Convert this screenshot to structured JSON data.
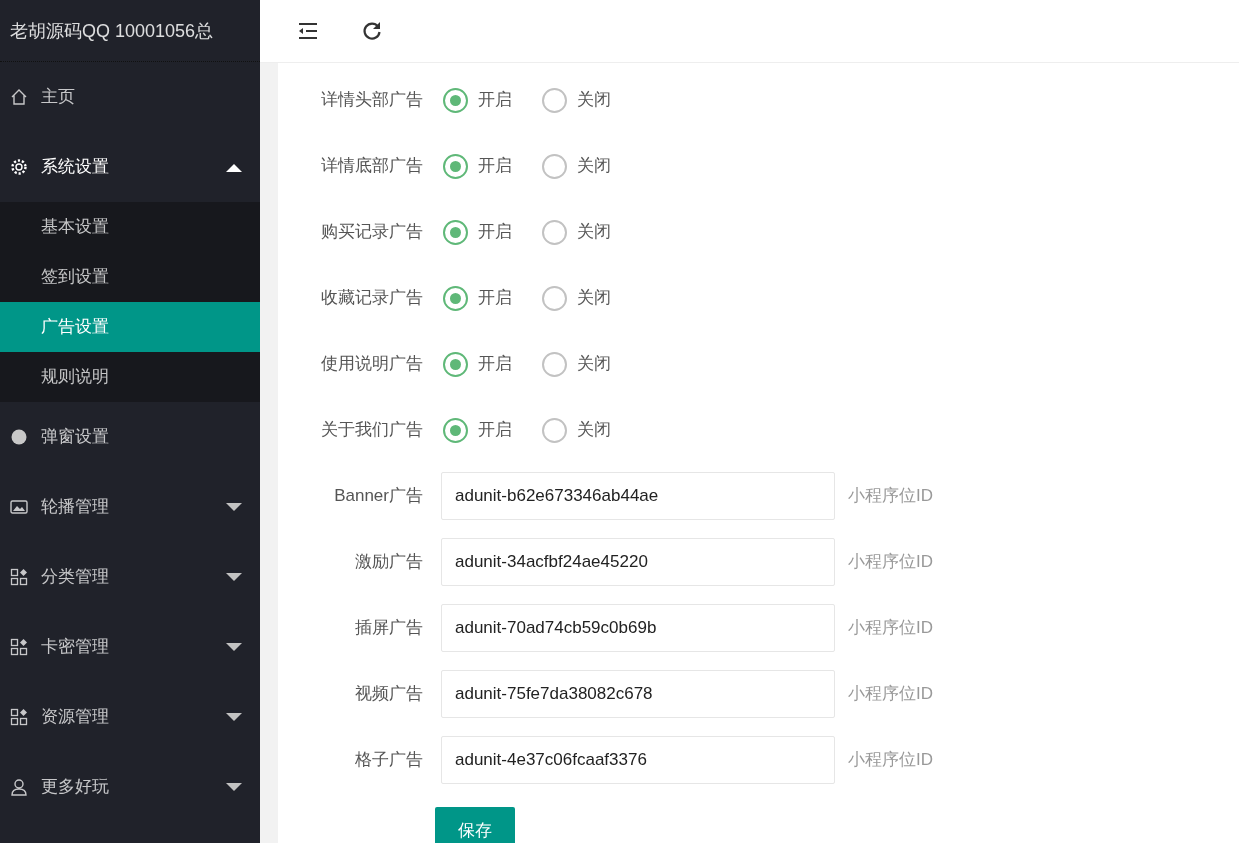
{
  "brand": "老胡源码QQ 10001056总",
  "sidebar": {
    "items": [
      {
        "label": "主页",
        "kind": "home"
      },
      {
        "label": "系统设置",
        "kind": "gear",
        "expanded": true,
        "children": [
          {
            "label": "基本设置",
            "selected": false
          },
          {
            "label": "签到设置",
            "selected": false
          },
          {
            "label": "广告设置",
            "selected": true
          },
          {
            "label": "规则说明",
            "selected": false
          }
        ]
      },
      {
        "label": "弹窗设置",
        "kind": "circle"
      },
      {
        "label": "轮播管理",
        "kind": "image",
        "expanded": false
      },
      {
        "label": "分类管理",
        "kind": "grid",
        "expanded": false
      },
      {
        "label": "卡密管理",
        "kind": "grid",
        "expanded": false
      },
      {
        "label": "资源管理",
        "kind": "grid",
        "expanded": false
      },
      {
        "label": "更多好玩",
        "kind": "user",
        "expanded": false
      }
    ]
  },
  "ad_switches": [
    {
      "label": "详情头部广告",
      "options": [
        {
          "label": "开启",
          "selected": true
        },
        {
          "label": "关闭",
          "selected": false
        }
      ]
    },
    {
      "label": "详情底部广告",
      "options": [
        {
          "label": "开启",
          "selected": true
        },
        {
          "label": "关闭",
          "selected": false
        }
      ]
    },
    {
      "label": "购买记录广告",
      "options": [
        {
          "label": "开启",
          "selected": true
        },
        {
          "label": "关闭",
          "selected": false
        }
      ]
    },
    {
      "label": "收藏记录广告",
      "options": [
        {
          "label": "开启",
          "selected": true
        },
        {
          "label": "关闭",
          "selected": false
        }
      ]
    },
    {
      "label": "使用说明广告",
      "options": [
        {
          "label": "开启",
          "selected": true
        },
        {
          "label": "关闭",
          "selected": false
        }
      ]
    },
    {
      "label": "关于我们广告",
      "options": [
        {
          "label": "开启",
          "selected": true
        },
        {
          "label": "关闭",
          "selected": false
        }
      ]
    }
  ],
  "ad_units": [
    {
      "label": "Banner广告",
      "value": "adunit-b62e673346ab44ae",
      "hint": "小程序位ID"
    },
    {
      "label": "激励广告",
      "value": "adunit-34acfbf24ae45220",
      "hint": "小程序位ID"
    },
    {
      "label": "插屏广告",
      "value": "adunit-70ad74cb59c0b69b",
      "hint": "小程序位ID"
    },
    {
      "label": "视频广告",
      "value": "adunit-75fe7da38082c678",
      "hint": "小程序位ID"
    },
    {
      "label": "格子广告",
      "value": "adunit-4e37c06fcaaf3376",
      "hint": "小程序位ID"
    }
  ],
  "save_button": "保存"
}
